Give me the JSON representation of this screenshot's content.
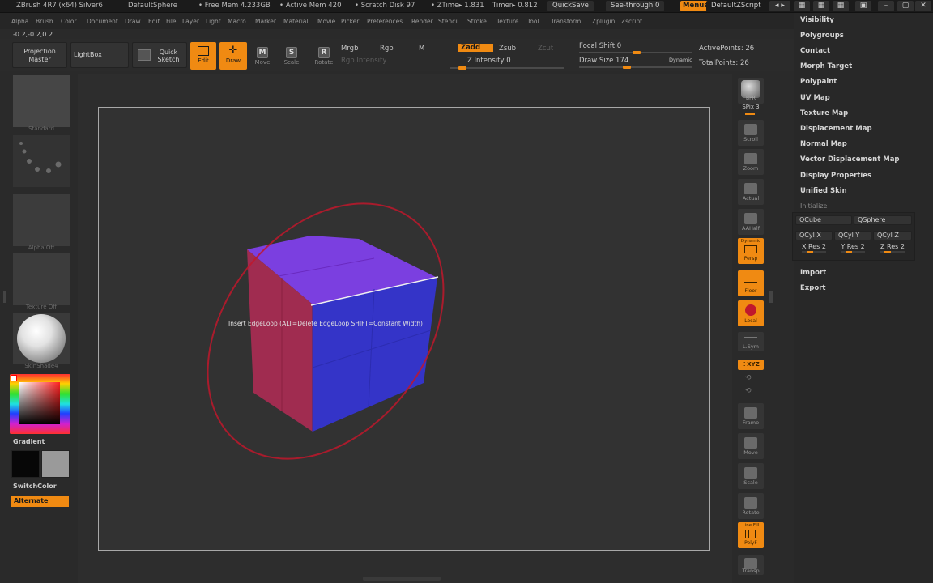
{
  "titlebar": {
    "app": "ZBrush 4R7 (x64) Silver6",
    "project": "DefaultSphere",
    "free_mem": "• Free Mem 4.233GB",
    "active_mem": "• Active Mem 420",
    "scratch": "• Scratch Disk 97",
    "ztime": "• ZTime▸ 1.831",
    "timer": "Timer▸ 0.812",
    "quicksave": "QuickSave",
    "see_through": "See-through  0",
    "menus": "Menus",
    "zscript": "DefaultZScript"
  },
  "menubar": [
    "Alpha",
    "Brush",
    "Color",
    "Document",
    "Draw",
    "Edit",
    "File",
    "Layer",
    "Light",
    "Macro",
    "Marker",
    "Material",
    "Movie",
    "Picker",
    "Preferences",
    "Render",
    "Stencil",
    "Stroke",
    "Texture",
    "Tool",
    "Transform",
    "Zplugin",
    "Zscript"
  ],
  "coords": "-0.2,-0.2,0.2",
  "toolbar": {
    "projection_master": "Projection Master",
    "lightbox": "LightBox",
    "quick_sketch": "Quick Sketch",
    "edit": "Edit",
    "draw": "Draw",
    "move": "Move",
    "scale": "Scale",
    "rotate": "Rotate",
    "mrgb": "Mrgb",
    "rgb": "Rgb",
    "m": "M",
    "rgb_intensity": "Rgb Intensity",
    "zadd": "Zadd",
    "zsub": "Zsub",
    "zcut": "Zcut",
    "z_intensity": "Z Intensity 0",
    "focal_shift": "Focal Shift 0",
    "draw_size": "Draw Size 174",
    "dynamic": "Dynamic",
    "active_points": "ActivePoints: 26",
    "total_points": "TotalPoints: 26"
  },
  "left": {
    "brush_caption": "Standard",
    "alpha_caption": "Alpha Off",
    "texture_caption": "Texture Off",
    "material_caption": "SkinShade4",
    "gradient": "Gradient",
    "switch_color": "SwitchColor",
    "alternate": "Alternate"
  },
  "viewport": {
    "tooltip": "Insert EdgeLoop (ALT=Delete EdgeLoop SHIFT=Constant Width)"
  },
  "shelf": {
    "bpr": "BPR",
    "spix": "SPix 3",
    "scroll": "Scroll",
    "zoom": "Zoom",
    "actual": "Actual",
    "aahalf": "AAHalf",
    "dynamic": "Dynamic",
    "persp": "Persp",
    "floor": "Floor",
    "local": "Local",
    "lsym": "L.Sym",
    "xyz": "⁘XYZ",
    "frame": "Frame",
    "move": "Move",
    "scale": "Scale",
    "rotate": "Rotate",
    "line_fill": "Line Fill",
    "polyf": "PolyF",
    "transp": "Transp"
  },
  "palette": {
    "items_top": [
      "Visibility",
      "Polygroups",
      "Contact",
      "Morph Target",
      "Polypaint",
      "UV Map",
      "Texture Map",
      "Displacement Map",
      "Normal Map",
      "Vector Displacement Map",
      "Display Properties",
      "Unified Skin"
    ],
    "initialize": "Initialize",
    "qcube": "QCube",
    "qsphere": "QSphere",
    "qcyl_x": "QCyl X",
    "qcyl_y": "QCyl Y",
    "qcyl_z": "QCyl Z",
    "x_res": "X Res 2",
    "y_res": "Y Res 2",
    "z_res": "Z Res 2",
    "import": "Import",
    "export": "Export"
  },
  "colors": {
    "accent": "#f08a12",
    "cube_top": "#7b3fe0",
    "cube_front": "#3434c8",
    "cube_side": "#a02c50",
    "gizmo_ring": "#c0182c"
  }
}
